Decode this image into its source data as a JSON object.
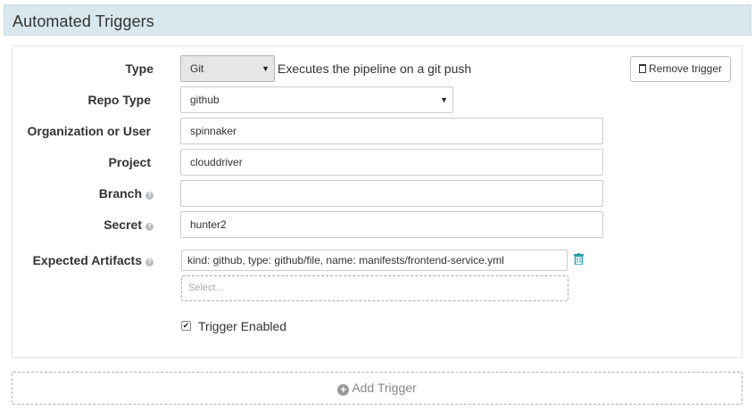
{
  "header": {
    "title": "Automated Triggers"
  },
  "trigger": {
    "type": {
      "label": "Type",
      "value": "Git",
      "description": "Executes the pipeline on a git push"
    },
    "remove_label": "Remove trigger",
    "repo_type": {
      "label": "Repo Type",
      "value": "github"
    },
    "organization": {
      "label": "Organization or User",
      "value": "spinnaker"
    },
    "project": {
      "label": "Project",
      "value": "clouddriver"
    },
    "branch": {
      "label": "Branch",
      "value": ""
    },
    "secret": {
      "label": "Secret",
      "value": "hunter2"
    },
    "expected_artifacts": {
      "label": "Expected Artifacts",
      "value": "kind: github, type: github/file, name: manifests/frontend-service.yml",
      "select_placeholder": "Select..."
    },
    "enabled": {
      "label": "Trigger Enabled",
      "checked": true
    }
  },
  "add_trigger_label": "Add Trigger",
  "colors": {
    "header_bg": "#d9e8ee",
    "accent_teal": "#2a9fb0"
  },
  "icons": {
    "remove": "trash-icon",
    "artifact_delete": "trash-icon",
    "help": "question-circle-icon",
    "add": "plus-circle-icon"
  }
}
